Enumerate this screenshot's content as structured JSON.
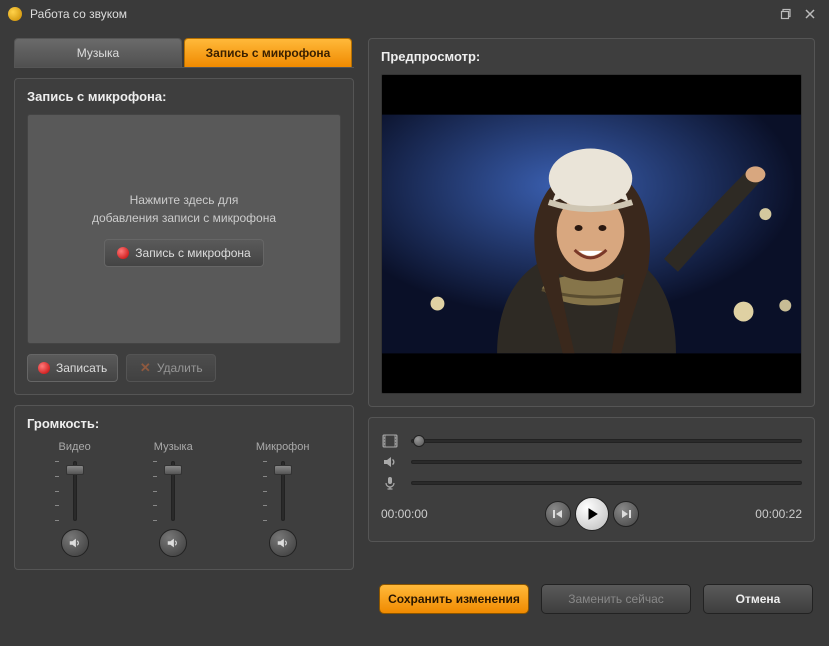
{
  "window": {
    "title": "Работа со звуком"
  },
  "tabs": {
    "music": "Музыка",
    "microphone": "Запись с микрофона"
  },
  "record_panel": {
    "title": "Запись с микрофона:",
    "hint_line1": "Нажмите здесь для",
    "hint_line2": "добавления записи с микрофона",
    "record_from_mic": "Запись с микрофона",
    "record": "Записать",
    "delete": "Удалить"
  },
  "volume_panel": {
    "title": "Громкость:",
    "video": "Видео",
    "music": "Музыка",
    "microphone": "Микрофон"
  },
  "preview": {
    "title": "Предпросмотр:"
  },
  "playback": {
    "current": "00:00:00",
    "total": "00:00:22"
  },
  "footer": {
    "save": "Сохранить изменения",
    "replace_now": "Заменить сейчас",
    "cancel": "Отмена"
  }
}
